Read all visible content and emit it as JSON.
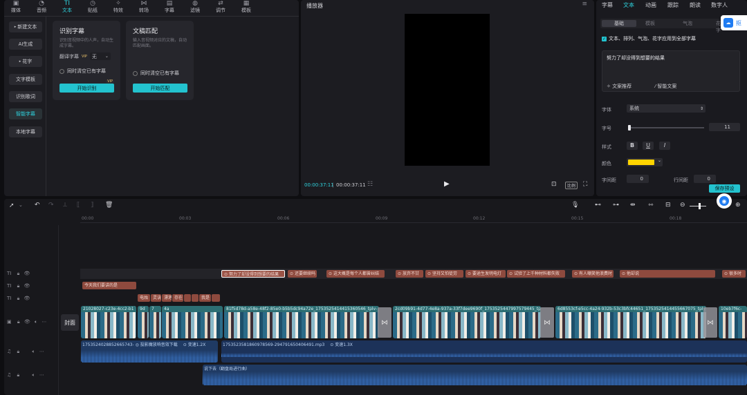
{
  "toolbar": {
    "tabs": [
      {
        "label": "媒体",
        "icon": "media-icon"
      },
      {
        "label": "音频",
        "icon": "audio-icon"
      },
      {
        "label": "文本",
        "icon": "text-icon"
      },
      {
        "label": "贴纸",
        "icon": "sticker-icon"
      },
      {
        "label": "特效",
        "icon": "effects-icon"
      },
      {
        "label": "转场",
        "icon": "transition-icon"
      },
      {
        "label": "字幕",
        "icon": "subtitle-icon"
      },
      {
        "label": "滤镜",
        "icon": "filter-icon"
      },
      {
        "label": "调节",
        "icon": "adjust-icon"
      },
      {
        "label": "模板",
        "icon": "template-icon"
      }
    ]
  },
  "sidebar": {
    "items": [
      {
        "label": "新建文本"
      },
      {
        "label": "AI生成"
      },
      {
        "label": "花字"
      },
      {
        "label": "文字模板"
      },
      {
        "label": "识别歌词"
      },
      {
        "label": "智能字幕"
      },
      {
        "label": "本地字幕"
      }
    ]
  },
  "cards": {
    "recognize": {
      "title": "识别字幕",
      "desc": "识别音视频中的人声，自动生成字幕。",
      "translate_label": "翻译字幕",
      "translate_value": "无",
      "clear_label": "同时清空已有字幕",
      "button": "开始识别",
      "badge": "VIP"
    },
    "match": {
      "title": "文稿匹配",
      "desc": "输入音视频对应的文稿，自动匹配画面。",
      "clear_label": "同时清空已有字幕",
      "button": "开始匹配"
    }
  },
  "player": {
    "title": "播放器",
    "time_current": "00:00:37:11",
    "time_total": "00:00:37:11",
    "ratio": "比例"
  },
  "right_panel": {
    "tabs": [
      "字幕",
      "文本",
      "动画",
      "跟踪",
      "朗读",
      "数字人"
    ],
    "subtabs": [
      "基础",
      "模板",
      "气泡",
      "花字"
    ],
    "apply_all": "文本、排列、气泡、花字应用到全部字幕",
    "text_content": "努力了却没得到想要的结果",
    "recommend": "文案推荐",
    "smart": "智能文案",
    "font_label": "字体",
    "font_value": "系统",
    "size_label": "字号",
    "size_value": "11",
    "style_label": "样式",
    "color_label": "颜色",
    "char_spacing_label": "字间距",
    "char_spacing_value": "0",
    "line_spacing_label": "行间距",
    "line_spacing_value": "0",
    "save_preset": "保存预设",
    "side_button": "抠",
    "color_value": "#FFD400"
  },
  "timeline": {
    "ruler": [
      "00:00",
      "00:03",
      "00:06",
      "00:09",
      "00:12",
      "00:15",
      "00:18"
    ],
    "cover_label": "封面",
    "caption_track_1": [
      "努力了却没得到想要的结果",
      "还要继续吗",
      "这大概是每个人都曾纠结",
      "放弃不甘",
      "坚持又怕徒劳",
      "要途生发明电灯",
      "试验了上千种材料都失败",
      "有人嘲笑他浪费时",
      "他却说",
      "很多时"
    ],
    "caption_track_2": [
      "今天我们要讲的是"
    ],
    "caption_track_3": [
      "电烛",
      "灵诀",
      "漂港",
      "存在",
      "",
      "",
      "我是",
      ""
    ],
    "video_clips": [
      "21028027-c23e-4cc2-b1",
      "9d",
      "7",
      "4a",
      "81f5d78d-a58e-48f2-85e0-b5b5dc94a72e_1753525414415360546_tplv-",
      "2cd09b91-4d77-4e8a-937a-33f7dee9690f_1753525447997579445_tplv-",
      "6d8553cf-e5cc-4a24-932b-53c3bfc44651_1753525414455667075_tplv",
      "10eb7f6c-"
    ],
    "audio_1": {
      "file1": "1753524028852665743-",
      "file1_name": "投影魔放响音效下载",
      "file1_speed": "变速1.2X",
      "file2": "17535235818609785​69-294791650406491.mp3",
      "file2_speed": "变速1.3X"
    },
    "audio_2": {
      "title": "说下去（翻盘局进行曲）"
    }
  }
}
